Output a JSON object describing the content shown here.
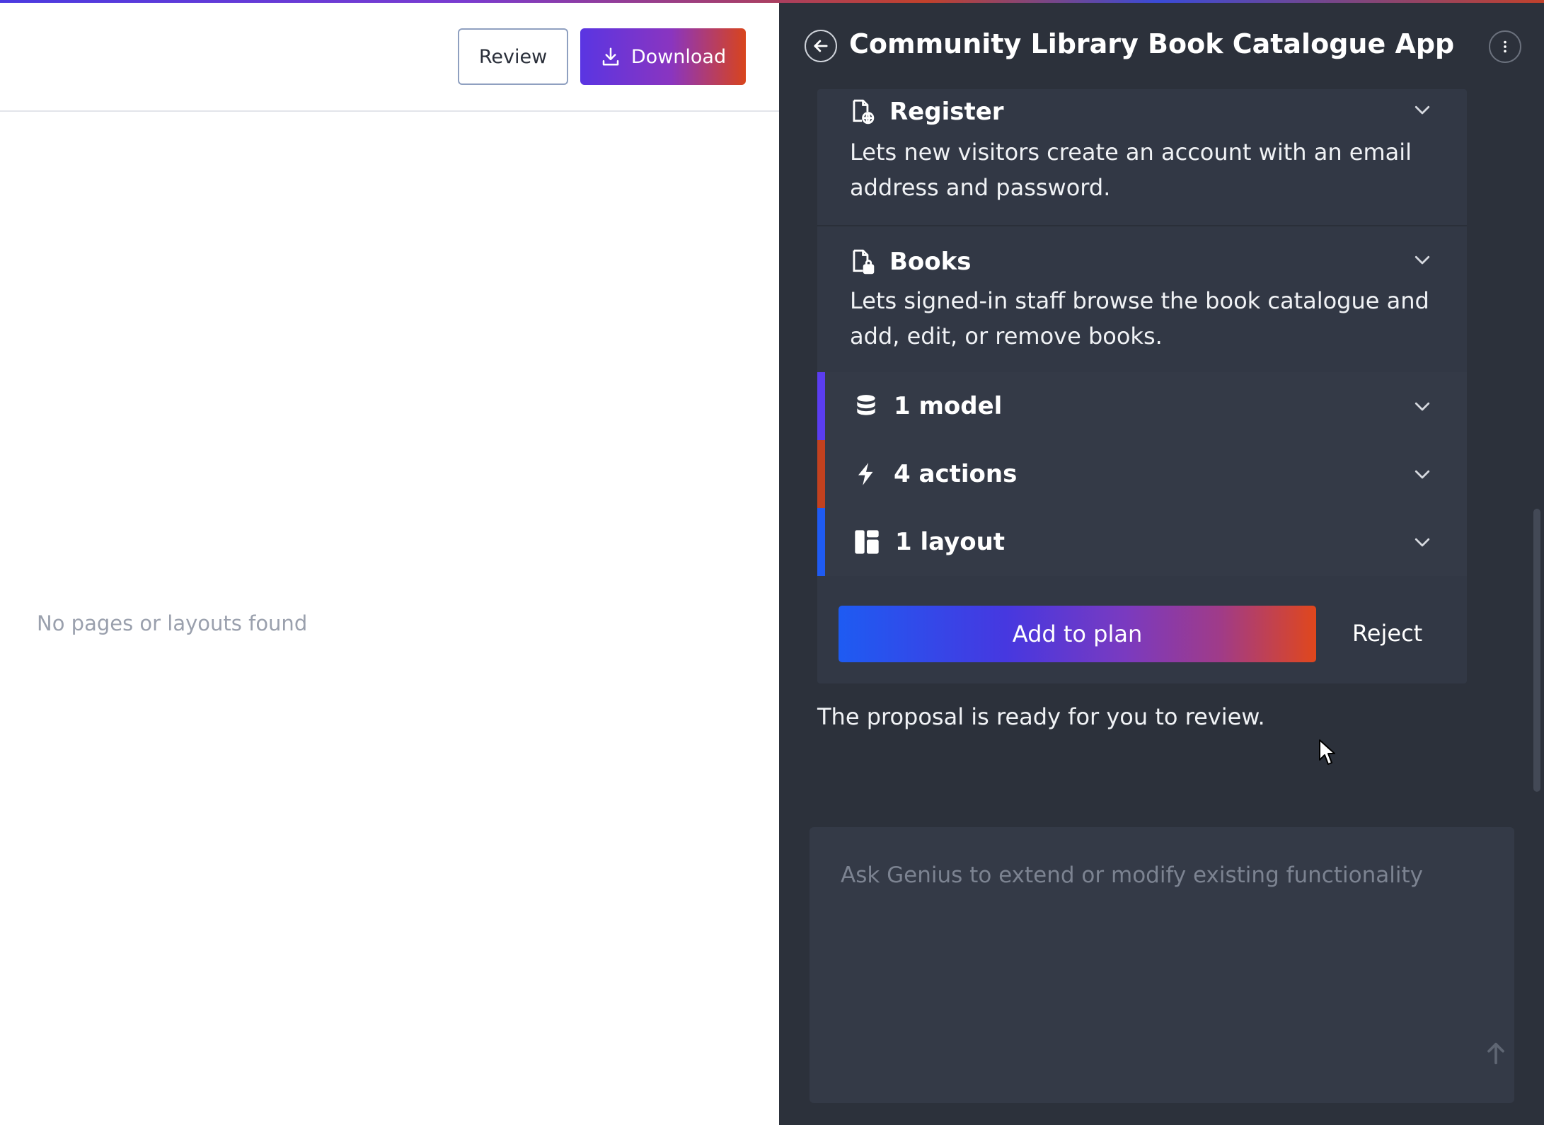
{
  "left": {
    "review_label": "Review",
    "download_label": "Download",
    "empty_message": "No pages or layouts found"
  },
  "panel": {
    "title": "Community Library Book Catalogue App",
    "pages": [
      {
        "title": "Register",
        "description": "Lets new visitors create an account with an email address and password.",
        "icon": "page-globe-icon"
      },
      {
        "title": "Books",
        "description": "Lets signed-in staff browse the book catalogue and add, edit, or remove books.",
        "icon": "page-lock-icon"
      }
    ],
    "summary": [
      {
        "label": "1 model",
        "icon": "database-icon",
        "color": "#5b3df0"
      },
      {
        "label": "4 actions",
        "icon": "lightning-icon",
        "color": "#c2411f"
      },
      {
        "label": "1 layout",
        "icon": "layout-icon",
        "color": "#1f5bf2"
      }
    ],
    "add_to_plan_label": "Add to plan",
    "reject_label": "Reject",
    "status_message": "The proposal is ready for you to review.",
    "input_placeholder": "Ask Genius to extend or modify existing functionality"
  }
}
